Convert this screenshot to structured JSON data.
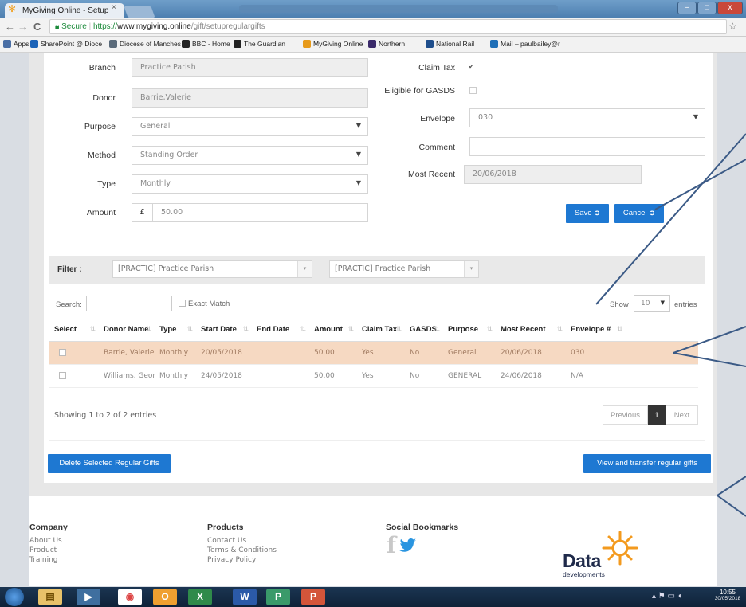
{
  "browser": {
    "tab_title": "MyGiving Online - Setup",
    "tab_close": "×",
    "back": "←",
    "forward": "→",
    "reload": "C",
    "secure_label": "Secure",
    "url_scheme": "https://",
    "url_domain": "www.mygiving.online",
    "url_path": "/gift/setupregulargifts",
    "star": "☆",
    "window_min": "–",
    "window_max": "□",
    "window_close": "x"
  },
  "bookmarks": [
    {
      "label": "Apps",
      "color": "#4a6fa5"
    },
    {
      "label": "SharePoint @ Dioce",
      "color": "#1c63b8"
    },
    {
      "label": "Diocese of Manches",
      "color": "#5a6a7a"
    },
    {
      "label": "BBC - Home",
      "color": "#222222"
    },
    {
      "label": "The Guardian",
      "color": "#222222"
    },
    {
      "label": "MyGiving Online",
      "color": "#e79a1a"
    },
    {
      "label": "Northern",
      "color": "#3a2a6a"
    },
    {
      "label": "National Rail",
      "color": "#1f4e8c"
    },
    {
      "label": "Mail – paulbailey@r",
      "color": "#1f6fb7"
    }
  ],
  "form": {
    "branch_label": "Branch",
    "branch_value": "Practice Parish",
    "donor_label": "Donor",
    "donor_value": "Barrie,Valerie",
    "purpose_label": "Purpose",
    "purpose_value": "General",
    "method_label": "Method",
    "method_value": "Standing Order",
    "type_label": "Type",
    "type_value": "Monthly",
    "amount_label": "Amount",
    "currency_symbol": "£",
    "amount_value": "50.00",
    "claim_tax_label": "Claim Tax",
    "claim_tax_mark": "✔",
    "gasds_label": "Eligible for GASDS",
    "envelope_label": "Envelope",
    "envelope_value": "030",
    "comment_label": "Comment",
    "comment_value": "",
    "most_recent_label": "Most Recent",
    "most_recent_value": "20/06/2018",
    "save_label": "Save",
    "cancel_label": "Cancel",
    "caret": "▼"
  },
  "filter": {
    "label": "Filter :",
    "select1": "[PRACTIC] Practice Parish",
    "select2": "[PRACTIC] Practice Parish"
  },
  "table_controls": {
    "search_label": "Search:",
    "exact_match_label": "Exact Match",
    "show_label": "Show",
    "show_value": "10",
    "entries_label": "entries"
  },
  "table": {
    "headers": [
      "Select",
      "Donor Name",
      "Type",
      "Start Date",
      "End Date",
      "Amount",
      "Claim Tax",
      "GASDS",
      "Purpose",
      "Most Recent",
      "Envelope #"
    ],
    "rows": [
      {
        "donor": "Barrie, Valerie",
        "type": "Monthly",
        "start": "20/05/2018",
        "end": "",
        "amount": "50.00",
        "claim_tax": "Yes",
        "gasds": "No",
        "purpose": "General",
        "most_recent": "20/06/2018",
        "envelope": "030",
        "selected": true
      },
      {
        "donor": "Williams, George",
        "type": "Monthly",
        "start": "24/05/2018",
        "end": "",
        "amount": "50.00",
        "claim_tax": "Yes",
        "gasds": "No",
        "purpose": "GENERAL",
        "most_recent": "24/06/2018",
        "envelope": "N/A",
        "selected": false
      }
    ],
    "sort_glyph": "⇅",
    "info": "Showing 1 to 2 of 2 entries",
    "previous": "Previous",
    "page": "1",
    "next": "Next"
  },
  "actions": {
    "delete_label": "Delete Selected Regular Gifts",
    "transfer_label": "View and transfer regular gifts"
  },
  "footer": {
    "company_heading": "Company",
    "company_links": [
      "About Us",
      "Product",
      "Training"
    ],
    "products_heading": "Products",
    "products_links": [
      "Contact Us",
      "Terms & Conditions",
      "Privacy Policy"
    ],
    "social_heading": "Social Bookmarks",
    "facebook_glyph": "f",
    "logo_text": "Data",
    "logo_sub": "developments",
    "brand_color": "#f39a1e"
  },
  "taskbar": {
    "time": "10:55",
    "date": "30/05/2018"
  },
  "colors": {
    "primary_button": "#1e78d2",
    "selected_row": "#f6d9c2",
    "annotation_arrow": "#3b5a86"
  }
}
